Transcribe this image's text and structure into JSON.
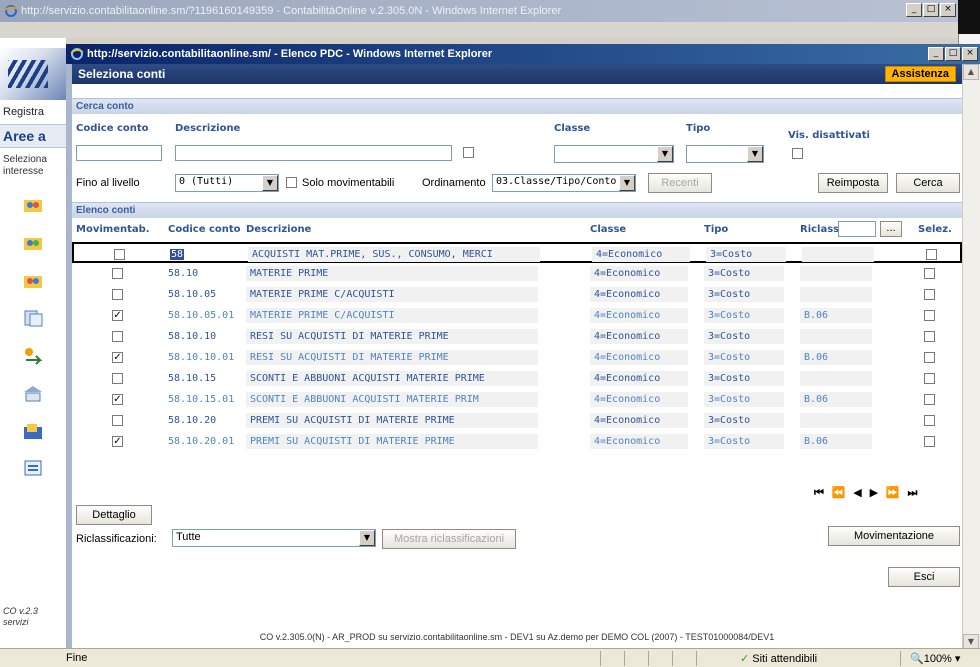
{
  "outer_window": {
    "title": "http://servizio.contabilitaonline.sm/?1196160149359 - ContabilitàOnline v.2.305.0N - Windows Internet Explorer"
  },
  "left_panel": {
    "registra_label": "Registra",
    "aree_label": "Aree a",
    "seleziona_label": "Seleziona",
    "interesse_label": "interesse",
    "footer_version": "CO v.2.3",
    "footer_servizi": "servizi"
  },
  "popup": {
    "title": "http://servizio.contabilitaonline.sm/ - Elenco PDC - Windows Internet Explorer",
    "header_title": "Seleziona conti",
    "assist_label": "Assistenza"
  },
  "search": {
    "section_title": "Cerca conto",
    "codice_label": "Codice conto",
    "descrizione_label": "Descrizione",
    "classe_label": "Classe",
    "tipo_label": "Tipo",
    "vis_disattivati_label": "Vis. disattivati",
    "codice_value": "",
    "descrizione_value": "",
    "classe_value": "",
    "tipo_value": "",
    "fino_livello_label": "Fino al livello",
    "livello_value": "0 (Tutti)",
    "solo_movimentabili_label": "Solo movimentabili",
    "ordinamento_label": "Ordinamento",
    "ordinamento_value": "03.Classe/Tipo/Conto",
    "recenti_button": "Recenti",
    "reimposta_button": "Reimposta",
    "cerca_button": "Cerca"
  },
  "list": {
    "section_title": "Elenco conti",
    "headers": {
      "movimentab": "Movimentab.",
      "codice": "Codice conto",
      "descrizione": "Descrizione",
      "classe": "Classe",
      "tipo": "Tipo",
      "riclass": "Riclass.",
      "selez": "Selez."
    },
    "riclass_filter_value": "",
    "riclass_button": "...",
    "rows": [
      {
        "mov": "",
        "code": "58",
        "desc": "ACQUISTI MAT.PRIME, SUS., CONSUMO, MERCI",
        "classe": "4=Economico",
        "tipo": "3=Costo",
        "riclass": "",
        "sel": ""
      },
      {
        "mov": "",
        "code": "58.10",
        "desc": "MATERIE PRIME",
        "classe": "4=Economico",
        "tipo": "3=Costo",
        "riclass": "",
        "sel": ""
      },
      {
        "mov": "",
        "code": "58.10.05",
        "desc": "MATERIE PRIME C/ACQUISTI",
        "classe": "4=Economico",
        "tipo": "3=Costo",
        "riclass": "",
        "sel": ""
      },
      {
        "mov": "✓",
        "code": "58.10.05.01",
        "desc": "MATERIE PRIME C/ACQUISTI",
        "classe": "4=Economico",
        "tipo": "3=Costo",
        "riclass": "B.06",
        "sel": ""
      },
      {
        "mov": "",
        "code": "58.10.10",
        "desc": "RESI SU ACQUISTI DI MATERIE PRIME",
        "classe": "4=Economico",
        "tipo": "3=Costo",
        "riclass": "",
        "sel": ""
      },
      {
        "mov": "✓",
        "code": "58.10.10.01",
        "desc": "RESI SU ACQUISTI DI MATERIE PRIME",
        "classe": "4=Economico",
        "tipo": "3=Costo",
        "riclass": "B.06",
        "sel": ""
      },
      {
        "mov": "",
        "code": "58.10.15",
        "desc": "SCONTI E ABBUONI ACQUISTI MATERIE PRIME",
        "classe": "4=Economico",
        "tipo": "3=Costo",
        "riclass": "",
        "sel": ""
      },
      {
        "mov": "✓",
        "code": "58.10.15.01",
        "desc": "SCONTI E ABBUONI ACQUISTI MATERIE PRIM",
        "classe": "4=Economico",
        "tipo": "3=Costo",
        "riclass": "B.06",
        "sel": ""
      },
      {
        "mov": "",
        "code": "58.10.20",
        "desc": "PREMI SU ACQUISTI DI MATERIE PRIME",
        "classe": "4=Economico",
        "tipo": "3=Costo",
        "riclass": "",
        "sel": ""
      },
      {
        "mov": "✓",
        "code": "58.10.20.01",
        "desc": "PREMI SU ACQUISTI DI MATERIE PRIME",
        "classe": "4=Economico",
        "tipo": "3=Costo",
        "riclass": "B.06",
        "sel": ""
      }
    ],
    "pager": {
      "first": "⏮",
      "prev_fast": "⏪",
      "prev": "◀",
      "next": "▶",
      "next_fast": "⏩",
      "last": "⏭"
    }
  },
  "actions": {
    "dettaglio_button": "Dettaglio",
    "riclassificazioni_label": "Riclassificazioni:",
    "riclassificazioni_value": "Tutte",
    "mostra_button": "Mostra riclassificazioni",
    "movimentazione_button": "Movimentazione",
    "esci_button": "Esci"
  },
  "footer": {
    "text": "CO v.2.305.0(N) - AR_PROD su servizio.contabilitaonline.sm - DEV1 su Az.demo per DEMO COL (2007) - TEST01000084/DEV1"
  },
  "statusbar": {
    "status": "Fine",
    "zone": "Siti attendibili",
    "zoom": "100%"
  },
  "colors": {
    "accent": "#2f5597",
    "header_bar": "#1d3569",
    "assist": "#ffb400"
  }
}
